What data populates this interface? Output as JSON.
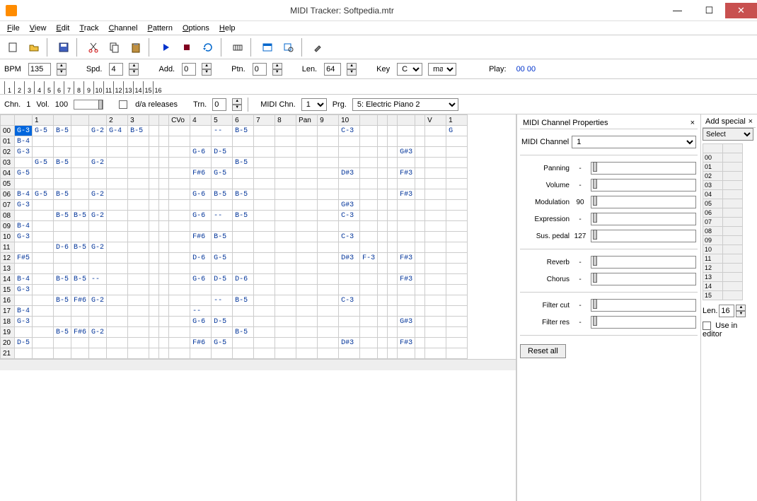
{
  "titlebar": {
    "title": "MIDI Tracker: Softpedia.mtr"
  },
  "menu": [
    "File",
    "View",
    "Edit",
    "Track",
    "Channel",
    "Pattern",
    "Options",
    "Help"
  ],
  "params": {
    "bpm_label": "BPM",
    "bpm": "135",
    "spd_label": "Spd.",
    "spd": "4",
    "add_label": "Add.",
    "add": "0",
    "ptn_label": "Ptn.",
    "ptn": "0",
    "len_label": "Len.",
    "len": "64",
    "key_label": "Key",
    "key": "C",
    "key_mode": "maj",
    "play_label": "Play:",
    "play_time": "00 00"
  },
  "ruler_count": 16,
  "chn": {
    "chn_label": "Chn.",
    "chn": "1",
    "vol_label": "Vol.",
    "vol": "100",
    "da_label": "d/a releases",
    "trn_label": "Trn.",
    "trn": "0",
    "midi_chn_label": "MIDI Chn.",
    "midi_chn": "1",
    "prg_label": "Prg.",
    "prg": "5: Electric Piano 2"
  },
  "grid": {
    "headers": [
      "",
      "1",
      "",
      "",
      "",
      "2",
      "3",
      "",
      "",
      "CVo",
      "4",
      "5",
      "6",
      "7",
      "8",
      "Pan",
      "9",
      "10",
      "",
      "",
      "",
      "",
      "",
      "V",
      "1"
    ],
    "rows": [
      {
        "n": "00",
        "c": {
          "0": [
            "G-3",
            "sel"
          ],
          "1": "G-5",
          "2": "B-5",
          "4": "G-2",
          "5": "G-4",
          "6": "B-5",
          "11": "--",
          "12": "B-5",
          "17": "C-3",
          "24": "G"
        }
      },
      {
        "n": "01",
        "c": {
          "0": "B-4"
        }
      },
      {
        "n": "02",
        "c": {
          "0": "G-3",
          "10": "G-6",
          "11": "D-5",
          "21": "G#3"
        }
      },
      {
        "n": "03",
        "c": {
          "1": "G-5",
          "2": "B-5",
          "4": "G-2",
          "12": "B-5"
        }
      },
      {
        "n": "04",
        "c": {
          "0": "G-5",
          "10": "F#6",
          "11": "G-5",
          "17": "D#3",
          "21": "F#3"
        }
      },
      {
        "n": "05",
        "c": {}
      },
      {
        "n": "06",
        "c": {
          "0": "B-4",
          "1": "G-5",
          "2": "B-5",
          "4": "G-2",
          "10": "G-6",
          "11": "B-5",
          "12": "B-5",
          "21": "F#3"
        }
      },
      {
        "n": "07",
        "c": {
          "0": "G-3",
          "17": "G#3"
        }
      },
      {
        "n": "08",
        "c": {
          "2": "B-5",
          "3": "B-5",
          "4": "G-2",
          "10": "G-6",
          "11": "--",
          "12": "B-5",
          "17": "C-3"
        }
      },
      {
        "n": "09",
        "c": {
          "0": "B-4"
        }
      },
      {
        "n": "10",
        "c": {
          "0": "G-3",
          "10": "F#6",
          "11": "B-5",
          "17": "C-3"
        }
      },
      {
        "n": "11",
        "c": {
          "2": "D-6",
          "3": "B-5",
          "4": "G-2"
        }
      },
      {
        "n": "12",
        "c": {
          "0": "F#5",
          "10": "D-6",
          "11": "G-5",
          "17": "D#3",
          "18": "F-3",
          "21": "F#3"
        }
      },
      {
        "n": "13",
        "c": {}
      },
      {
        "n": "14",
        "c": {
          "0": "B-4",
          "2": "B-5",
          "3": "B-5",
          "4": "--",
          "10": "G-6",
          "11": "D-5",
          "12": "D-6",
          "21": "F#3"
        }
      },
      {
        "n": "15",
        "c": {
          "0": "G-3"
        }
      },
      {
        "n": "16",
        "c": {
          "2": "B-5",
          "3": "F#6",
          "4": "G-2",
          "11": "--",
          "12": "B-5",
          "17": "C-3"
        }
      },
      {
        "n": "17",
        "c": {
          "0": "B-4",
          "10": "--"
        }
      },
      {
        "n": "18",
        "c": {
          "0": "G-3",
          "10": "G-6",
          "11": "D-5",
          "21": "G#3"
        }
      },
      {
        "n": "19",
        "c": {
          "2": "B-5",
          "3": "F#6",
          "4": "G-2",
          "12": "B-5"
        }
      },
      {
        "n": "20",
        "c": {
          "0": "D-5",
          "10": "F#6",
          "11": "G-5",
          "17": "D#3",
          "21": "F#3"
        }
      },
      {
        "n": "21",
        "c": {}
      }
    ]
  },
  "side": {
    "title": "MIDI Channel Properties",
    "midi_chn_label": "MIDI Channel",
    "midi_chn": "1",
    "props": [
      {
        "label": "Panning",
        "val": "-"
      },
      {
        "label": "Volume",
        "val": "-"
      },
      {
        "label": "Modulation",
        "val": "90"
      },
      {
        "label": "Expression",
        "val": "-"
      },
      {
        "label": "Sus. pedal",
        "val": "127"
      }
    ],
    "fx": [
      {
        "label": "Reverb",
        "val": "-"
      },
      {
        "label": "Chorus",
        "val": "-"
      }
    ],
    "filter": [
      {
        "label": "Filter cut",
        "val": "-"
      },
      {
        "label": "Filter res",
        "val": "-"
      }
    ],
    "reset": "Reset all"
  },
  "add": {
    "title": "Add special",
    "select": "Select",
    "rows": 16,
    "len_label": "Len.",
    "len": "16",
    "use_label": "Use in editor"
  }
}
